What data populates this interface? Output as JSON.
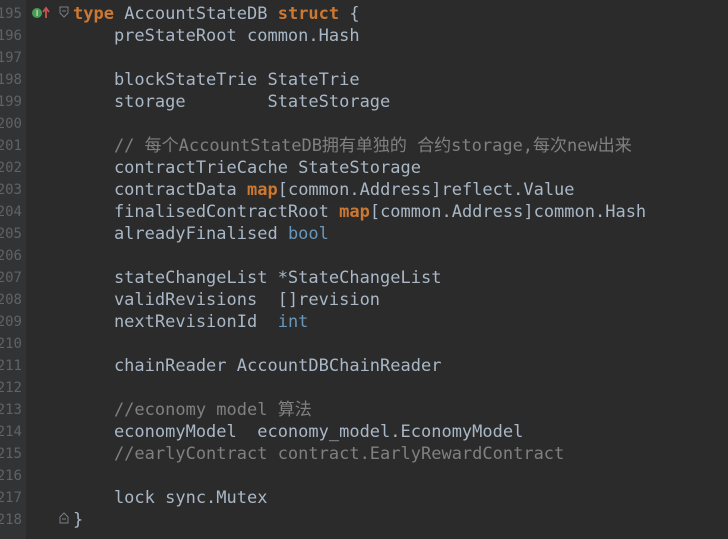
{
  "editor": {
    "lines": [
      {
        "number": "195",
        "tokens": [
          {
            "t": "type",
            "c": "kw"
          },
          {
            "t": " AccountStateDB ",
            "c": "plain"
          },
          {
            "t": "struct",
            "c": "kw"
          },
          {
            "t": " {",
            "c": "plain"
          }
        ]
      },
      {
        "number": "196",
        "tokens": [
          {
            "t": "    preStateRoot common.Hash",
            "c": "plain"
          }
        ]
      },
      {
        "number": "197",
        "tokens": []
      },
      {
        "number": "198",
        "tokens": [
          {
            "t": "    blockStateTrie StateTrie",
            "c": "plain"
          }
        ]
      },
      {
        "number": "199",
        "tokens": [
          {
            "t": "    storage        StateStorage",
            "c": "plain"
          }
        ]
      },
      {
        "number": "200",
        "tokens": []
      },
      {
        "number": "201",
        "tokens": [
          {
            "t": "    // 每个AccountStateDB拥有单独的 合约storage,每次new出来",
            "c": "comment"
          }
        ]
      },
      {
        "number": "202",
        "tokens": [
          {
            "t": "    contractTrieCache StateStorage",
            "c": "plain"
          }
        ]
      },
      {
        "number": "203",
        "tokens": [
          {
            "t": "    contractData ",
            "c": "plain"
          },
          {
            "t": "map",
            "c": "kw"
          },
          {
            "t": "[common.Address]reflect.Value",
            "c": "plain"
          }
        ]
      },
      {
        "number": "204",
        "tokens": [
          {
            "t": "    finalisedContractRoot ",
            "c": "plain"
          },
          {
            "t": "map",
            "c": "kw"
          },
          {
            "t": "[common.Address]common.Hash",
            "c": "plain"
          }
        ]
      },
      {
        "number": "205",
        "tokens": [
          {
            "t": "    alreadyFinalised ",
            "c": "plain"
          },
          {
            "t": "bool",
            "c": "builtin"
          }
        ]
      },
      {
        "number": "206",
        "tokens": []
      },
      {
        "number": "207",
        "tokens": [
          {
            "t": "    stateChangeList *StateChangeList",
            "c": "plain"
          }
        ]
      },
      {
        "number": "208",
        "tokens": [
          {
            "t": "    validRevisions  []revision",
            "c": "plain"
          }
        ]
      },
      {
        "number": "209",
        "tokens": [
          {
            "t": "    nextRevisionId  ",
            "c": "plain"
          },
          {
            "t": "int",
            "c": "builtin"
          }
        ]
      },
      {
        "number": "210",
        "tokens": []
      },
      {
        "number": "211",
        "tokens": [
          {
            "t": "    chainReader AccountDBChainReader",
            "c": "plain"
          }
        ]
      },
      {
        "number": "212",
        "tokens": []
      },
      {
        "number": "213",
        "tokens": [
          {
            "t": "    //economy model 算法",
            "c": "comment"
          }
        ]
      },
      {
        "number": "214",
        "tokens": [
          {
            "t": "    economyModel  economy_model.EconomyModel",
            "c": "plain"
          }
        ]
      },
      {
        "number": "215",
        "tokens": [
          {
            "t": "    //earlyContract contract.EarlyRewardContract",
            "c": "comment"
          }
        ]
      },
      {
        "number": "216",
        "tokens": []
      },
      {
        "number": "217",
        "tokens": [
          {
            "t": "    lock sync.Mutex",
            "c": "plain"
          }
        ]
      },
      {
        "number": "218",
        "tokens": [
          {
            "t": "}",
            "c": "plain"
          }
        ]
      }
    ],
    "icons": {
      "override": "implements-interface-icon",
      "fold": "fold-marker-icon"
    },
    "colors": {
      "background": "#2b2b2b",
      "gutter": "#313335",
      "keyword": "#cc7832",
      "builtin_type": "#6897bb",
      "comment": "#808080",
      "text": "#a9b7c6",
      "line_number": "#606366"
    }
  }
}
